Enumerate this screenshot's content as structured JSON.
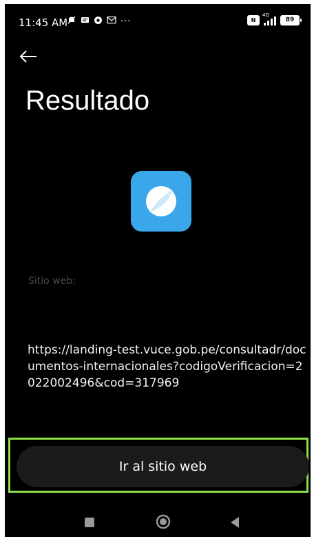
{
  "status_bar": {
    "time": "11:45 AM",
    "more_dots": "···",
    "nfc": "N",
    "network": "4G",
    "battery": "89"
  },
  "header": {
    "title": "Resultado"
  },
  "content": {
    "site_label": "Sitio web:",
    "url": "https://landing-test.vuce.gob.pe/consultadr/documentos-internacionales?codigoVerificacion=2022002496&cod=317969"
  },
  "actions": {
    "visit_button_label": "Ir al sitio web"
  },
  "colors": {
    "background": "#000000",
    "icon_bg": "#3aa7ea",
    "button_bg": "#1b1b1b",
    "highlight": "#8ee04a"
  },
  "icons": {
    "back": "arrow-left-icon",
    "app": "browser-compass-icon",
    "nav_recents": "square-icon",
    "nav_home": "circle-icon",
    "nav_back": "triangle-icon"
  }
}
